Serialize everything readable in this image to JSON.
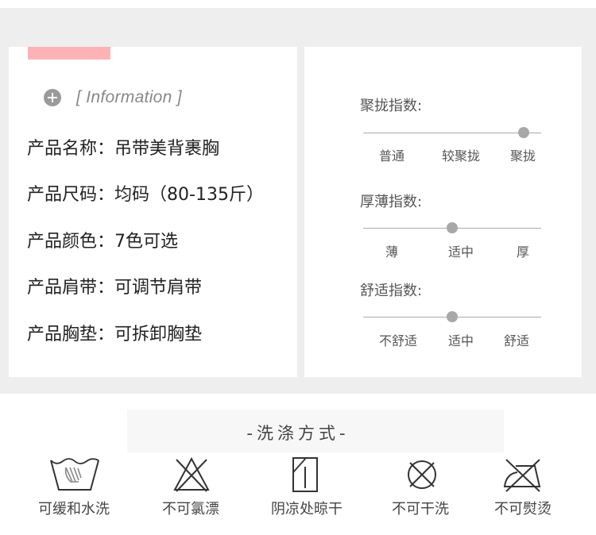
{
  "accent_color": "#fdb3b5",
  "info": {
    "title": "[ Information ]",
    "specs": [
      {
        "label": "产品名称：",
        "value": "吊带美背裹胸"
      },
      {
        "label": "产品尺码：",
        "value": "均码（80-135斤）"
      },
      {
        "label": "产品颜色：",
        "value": "7色可选"
      },
      {
        "label": "产品肩带：",
        "value": "可调节肩带"
      },
      {
        "label": "产品胸垫：",
        "value": "可拆卸胸垫"
      }
    ]
  },
  "indices": [
    {
      "title": "聚拢指数:",
      "labels": [
        "普通",
        "较聚拢",
        "聚拢"
      ],
      "level": 0.9
    },
    {
      "title": "厚薄指数:",
      "labels": [
        "薄",
        "适中",
        "厚"
      ],
      "level": 0.5
    },
    {
      "title": "舒适指数:",
      "labels": [
        "不舒适",
        "适中",
        "舒适"
      ],
      "level": 0.5
    }
  ],
  "wash": {
    "title": "-洗涤方式-",
    "items": [
      {
        "label": "可缓和水洗",
        "icon": "gentle-hand-wash-icon"
      },
      {
        "label": "不可氯漂",
        "icon": "no-bleach-icon"
      },
      {
        "label": "阴凉处晾干",
        "icon": "shade-dry-icon"
      },
      {
        "label": "不可干洗",
        "icon": "no-dry-clean-icon"
      },
      {
        "label": "不可熨烫",
        "icon": "no-iron-icon"
      }
    ]
  }
}
